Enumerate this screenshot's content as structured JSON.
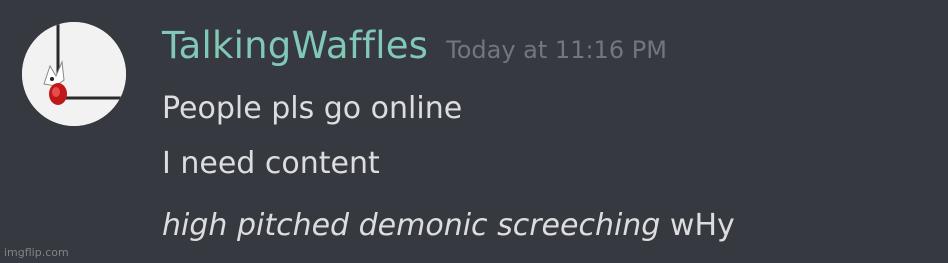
{
  "message": {
    "author": "TalkingWaffles",
    "timestamp": "Today at 11:16 PM",
    "avatar_icon": "user-avatar-icon",
    "lines": [
      {
        "text": "People pls go online"
      },
      {
        "text": "I need content"
      },
      {
        "italic": "high pitched demonic screeching",
        "text": "wHy"
      }
    ]
  },
  "watermark": "imgflip.com",
  "colors": {
    "background": "#36393f",
    "username": "#81c8b8",
    "timestamp": "#72767d",
    "text": "#dcddde"
  }
}
